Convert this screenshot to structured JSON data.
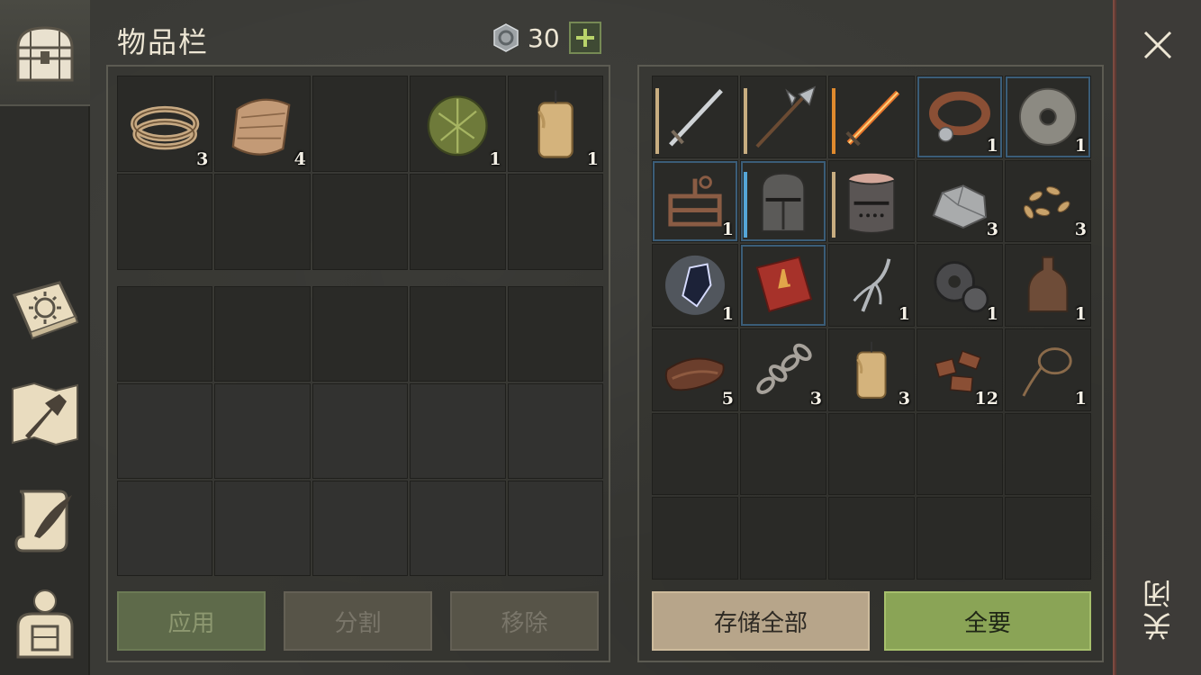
{
  "header": {
    "title": "物品栏",
    "currency_value": "30",
    "currency_icon": "silver-coin-icon",
    "add_label": "+"
  },
  "sidebar": {
    "items": [
      {
        "name": "chest-icon",
        "active": true
      },
      {
        "name": "sun-book-icon"
      },
      {
        "name": "crafting-map-icon"
      },
      {
        "name": "scroll-quill-icon"
      },
      {
        "name": "character-icon"
      }
    ]
  },
  "inventory": {
    "top_grid": [
      {
        "icon": "rope",
        "count": "3"
      },
      {
        "icon": "cloth",
        "count": "4"
      },
      {
        "icon": "",
        "count": ""
      },
      {
        "icon": "grass-ball",
        "count": "1"
      },
      {
        "icon": "candle",
        "count": "1"
      },
      {
        "icon": "",
        "count": ""
      },
      {
        "icon": "",
        "count": ""
      },
      {
        "icon": "",
        "count": ""
      },
      {
        "icon": "",
        "count": ""
      },
      {
        "icon": "",
        "count": ""
      }
    ],
    "buttons": {
      "apply": "应用",
      "split": "分割",
      "remove": "移除"
    }
  },
  "storage": {
    "items": [
      {
        "icon": "sword",
        "count": "",
        "durability": 0.85,
        "dur_color": "tan"
      },
      {
        "icon": "halberd",
        "count": "",
        "durability": 0.85,
        "dur_color": "tan"
      },
      {
        "icon": "flame-sword",
        "count": "",
        "durability": 0.85,
        "dur_color": "orange"
      },
      {
        "icon": "collar",
        "count": "1",
        "blue": true
      },
      {
        "icon": "grindstone",
        "count": "1",
        "blue": true
      },
      {
        "icon": "trap-frame",
        "count": "1",
        "blue": true
      },
      {
        "icon": "great-helm",
        "count": "",
        "durability": 0.85,
        "dur_color": "blue",
        "blue": true
      },
      {
        "icon": "bucket-helm",
        "count": "",
        "durability": 0.85,
        "dur_color": "tan"
      },
      {
        "icon": "iron-ore",
        "count": "3"
      },
      {
        "icon": "seeds",
        "count": "3"
      },
      {
        "icon": "crystal",
        "count": "1"
      },
      {
        "icon": "red-book",
        "count": "",
        "blue": true
      },
      {
        "icon": "claw-tool",
        "count": "1"
      },
      {
        "icon": "gears",
        "count": "1"
      },
      {
        "icon": "bottle",
        "count": "1"
      },
      {
        "icon": "leather",
        "count": "5"
      },
      {
        "icon": "chain",
        "count": "3"
      },
      {
        "icon": "candle",
        "count": "3"
      },
      {
        "icon": "scrap",
        "count": "12"
      },
      {
        "icon": "lasso",
        "count": "1"
      }
    ],
    "buttons": {
      "store_all": "存储全部",
      "take_all": "全要"
    }
  },
  "close": {
    "label": "关闭"
  },
  "colors": {
    "accent_green": "#8aa456",
    "accent_tan": "#b7a58a",
    "close_border": "#7c4a40",
    "rare_blue": "#3b5d78"
  }
}
